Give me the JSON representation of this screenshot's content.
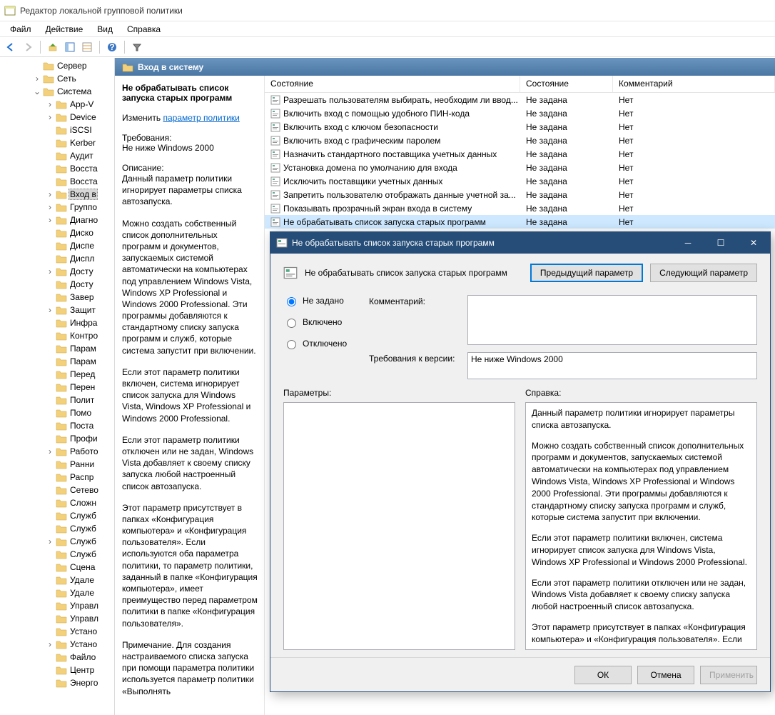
{
  "window": {
    "title": "Редактор локальной групповой политики"
  },
  "menus": [
    "Файл",
    "Действие",
    "Вид",
    "Справка"
  ],
  "tree": {
    "top": [
      {
        "label": "Сервер",
        "indent": 1,
        "expand": ""
      },
      {
        "label": "Сеть",
        "indent": 1,
        "expand": "›"
      },
      {
        "label": "Система",
        "indent": 1,
        "expand": "⌄"
      }
    ],
    "children": [
      "App-V",
      "Device",
      "iSCSI",
      "Kerber",
      "Аудит",
      "Восста",
      "Восста",
      "Вход в",
      "Группо",
      "Диагно",
      "Диско",
      "Диспе",
      "Диспл",
      "Досту",
      "Досту",
      "Завер",
      "Защит",
      "Инфра",
      "Контро",
      "Парам",
      "Парам",
      "Перед",
      "Перен",
      "Полит",
      "Помо",
      "Поста",
      "Профи",
      "Работо",
      "Ранни",
      "Распр",
      "Сетево",
      "Сложн",
      "Служб",
      "Служб",
      "Служб",
      "Служб",
      "Сцена",
      "Удале",
      "Удале",
      "Управл",
      "Управл",
      "Устано",
      "Устано",
      "Файло",
      "Центр",
      "Энерго"
    ],
    "selected_index": 7
  },
  "detail": {
    "header": "Вход в систему",
    "setting_title": "Не обрабатывать список запуска старых программ",
    "edit_prefix": "Изменить ",
    "edit_link": "параметр политики",
    "req_label": "Требования:",
    "req_value": "Не ниже Windows 2000",
    "desc_label": "Описание:",
    "desc_paragraphs": [
      "Данный параметр политики игнорирует параметры списка автозапуска.",
      "Можно создать собственный список дополнительных программ и документов, запускаемых системой автоматически на компьютерах под управлением Windows Vista, Windows XP Professional и Windows 2000 Professional. Эти программы добавляются к стандартному списку запуска программ и служб, которые система запустит при включении.",
      "Если этот параметр политики включен, система игнорирует список запуска для Windows Vista, Windows XP Professional и Windows 2000 Professional.",
      "Если этот параметр политики отключен или не задан, Windows Vista добавляет к своему списку запуска любой настроенный список автозапуска.",
      "Этот параметр присутствует в папках «Конфигурация компьютера» и «Конфигурация пользователя». Если используются оба параметра политики, то параметр политики, заданный в папке «Конфигурация компьютера», имеет преимущество перед параметром политики в папке «Конфигурация пользователя».",
      "Примечание. Для создания настраиваемого списка запуска при помощи параметра политики используется параметр политики «Выполнять"
    ]
  },
  "list": {
    "headers": [
      "Состояние",
      "Состояние",
      "Комментарий"
    ],
    "rows": [
      {
        "name": "Разрешать пользователям выбирать, необходим ли ввод...",
        "state": "Не задана",
        "comment": "Нет"
      },
      {
        "name": "Включить вход с помощью удобного ПИН-кода",
        "state": "Не задана",
        "comment": "Нет"
      },
      {
        "name": "Включить вход с ключом безопасности",
        "state": "Не задана",
        "comment": "Нет"
      },
      {
        "name": "Включить вход с графическим паролем",
        "state": "Не задана",
        "comment": "Нет"
      },
      {
        "name": "Назначить стандартного поставщика учетных данных",
        "state": "Не задана",
        "comment": "Нет"
      },
      {
        "name": "Установка домена по умолчанию для входа",
        "state": "Не задана",
        "comment": "Нет"
      },
      {
        "name": "Исключить поставщики учетных данных",
        "state": "Не задана",
        "comment": "Нет"
      },
      {
        "name": "Запретить пользователю отображать данные учетной за...",
        "state": "Не задана",
        "comment": "Нет"
      },
      {
        "name": "Показывать прозрачный экран входа в систему",
        "state": "Не задана",
        "comment": "Нет"
      },
      {
        "name": "Не обрабатывать список запуска старых программ",
        "state": "Не задана",
        "comment": "Нет",
        "selected": true
      }
    ]
  },
  "dialog": {
    "title": "Не обрабатывать список запуска старых программ",
    "name": "Не обрабатывать список запуска старых программ",
    "prev": "Предыдущий параметр",
    "next": "Следующий параметр",
    "radio_not": "Не задано",
    "radio_on": "Включено",
    "radio_off": "Отключено",
    "comment_label": "Комментарий:",
    "req_label": "Требования к версии:",
    "req_value": "Не ниже Windows 2000",
    "params_label": "Параметры:",
    "help_label": "Справка:",
    "help_paragraphs": [
      "Данный параметр политики игнорирует параметры списка автозапуска.",
      "Можно создать собственный список дополнительных программ и документов, запускаемых системой автоматически на компьютерах под управлением Windows Vista, Windows XP Professional и Windows 2000 Professional. Эти программы добавляются к стандартному списку запуска программ и служб, которые система запустит при включении.",
      "Если этот параметр политики включен, система игнорирует список запуска для Windows Vista, Windows XP Professional и Windows 2000 Professional.",
      "Если этот параметр политики отключен или не задан, Windows Vista добавляет к своему списку запуска любой настроенный список автозапуска.",
      "Этот параметр присутствует в папках «Конфигурация компьютера» и «Конфигурация пользователя». Если"
    ],
    "ok": "ОК",
    "cancel": "Отмена",
    "apply": "Применить"
  }
}
